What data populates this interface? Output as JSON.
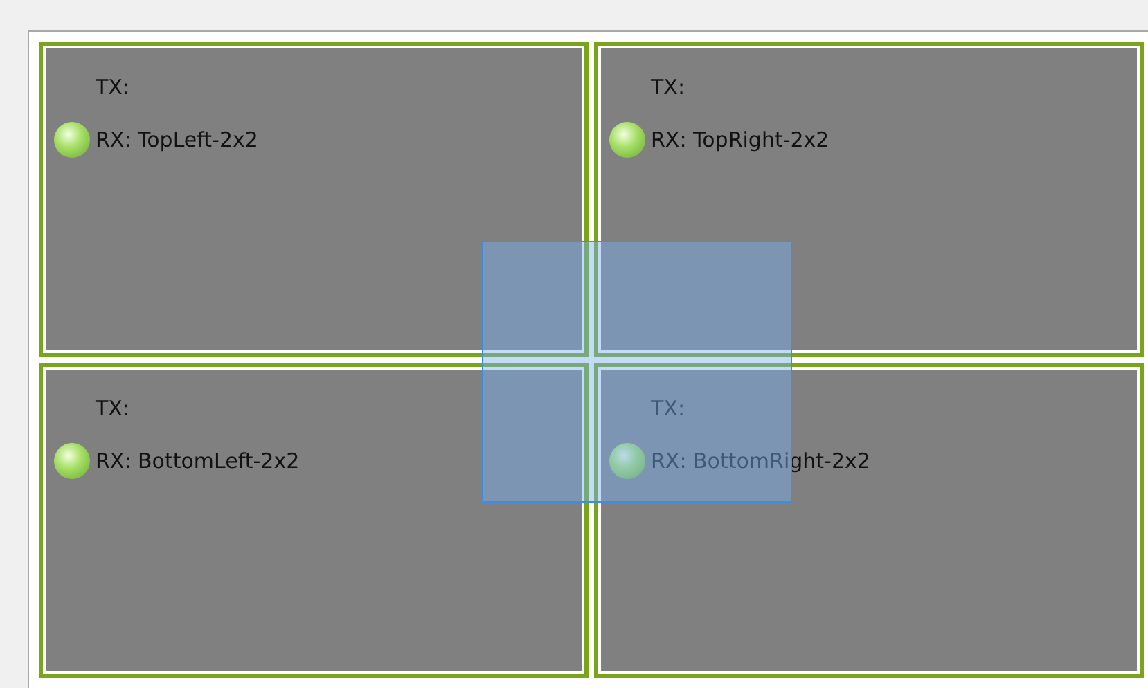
{
  "panels": [
    {
      "tx": "TX:",
      "rx": "RX: TopLeft-2x2",
      "connected": true
    },
    {
      "tx": "TX:",
      "rx": "RX: TopRight-2x2",
      "connected": true
    },
    {
      "tx": "TX:",
      "rx": "RX: BottomLeft-2x2",
      "connected": true
    },
    {
      "tx": "TX:",
      "rx": "RX: BottomRight-2x2",
      "connected": true
    }
  ]
}
